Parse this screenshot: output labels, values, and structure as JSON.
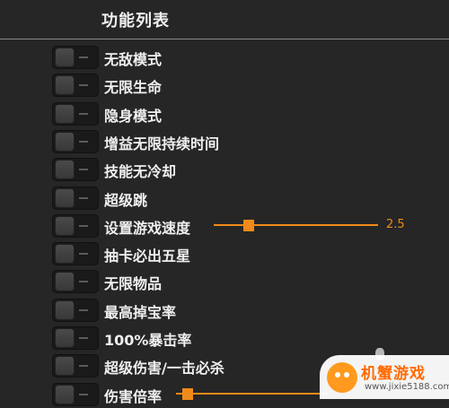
{
  "header": {
    "title": "功能列表"
  },
  "features": [
    {
      "label": "无敌模式"
    },
    {
      "label": "无限生命"
    },
    {
      "label": "隐身模式"
    },
    {
      "label": "增益无限持续时间"
    },
    {
      "label": "技能无冷却"
    },
    {
      "label": "超级跳"
    },
    {
      "label": "设置游戏速度",
      "slider": {
        "value": "2.5",
        "fraction": 0.18
      }
    },
    {
      "label": "抽卡必出五星"
    },
    {
      "label": "无限物品"
    },
    {
      "label": "最高掉宝率"
    },
    {
      "label": "100%暴击率"
    },
    {
      "label": "超级伤害/一击必杀"
    },
    {
      "label": "伤害倍率",
      "slider": {
        "fraction": 0.04
      }
    }
  ],
  "watermark": {
    "title": "机蟹游戏",
    "url": "www.jixie5188.com"
  },
  "colors": {
    "accent": "#f08a1a",
    "background": "#262626"
  }
}
